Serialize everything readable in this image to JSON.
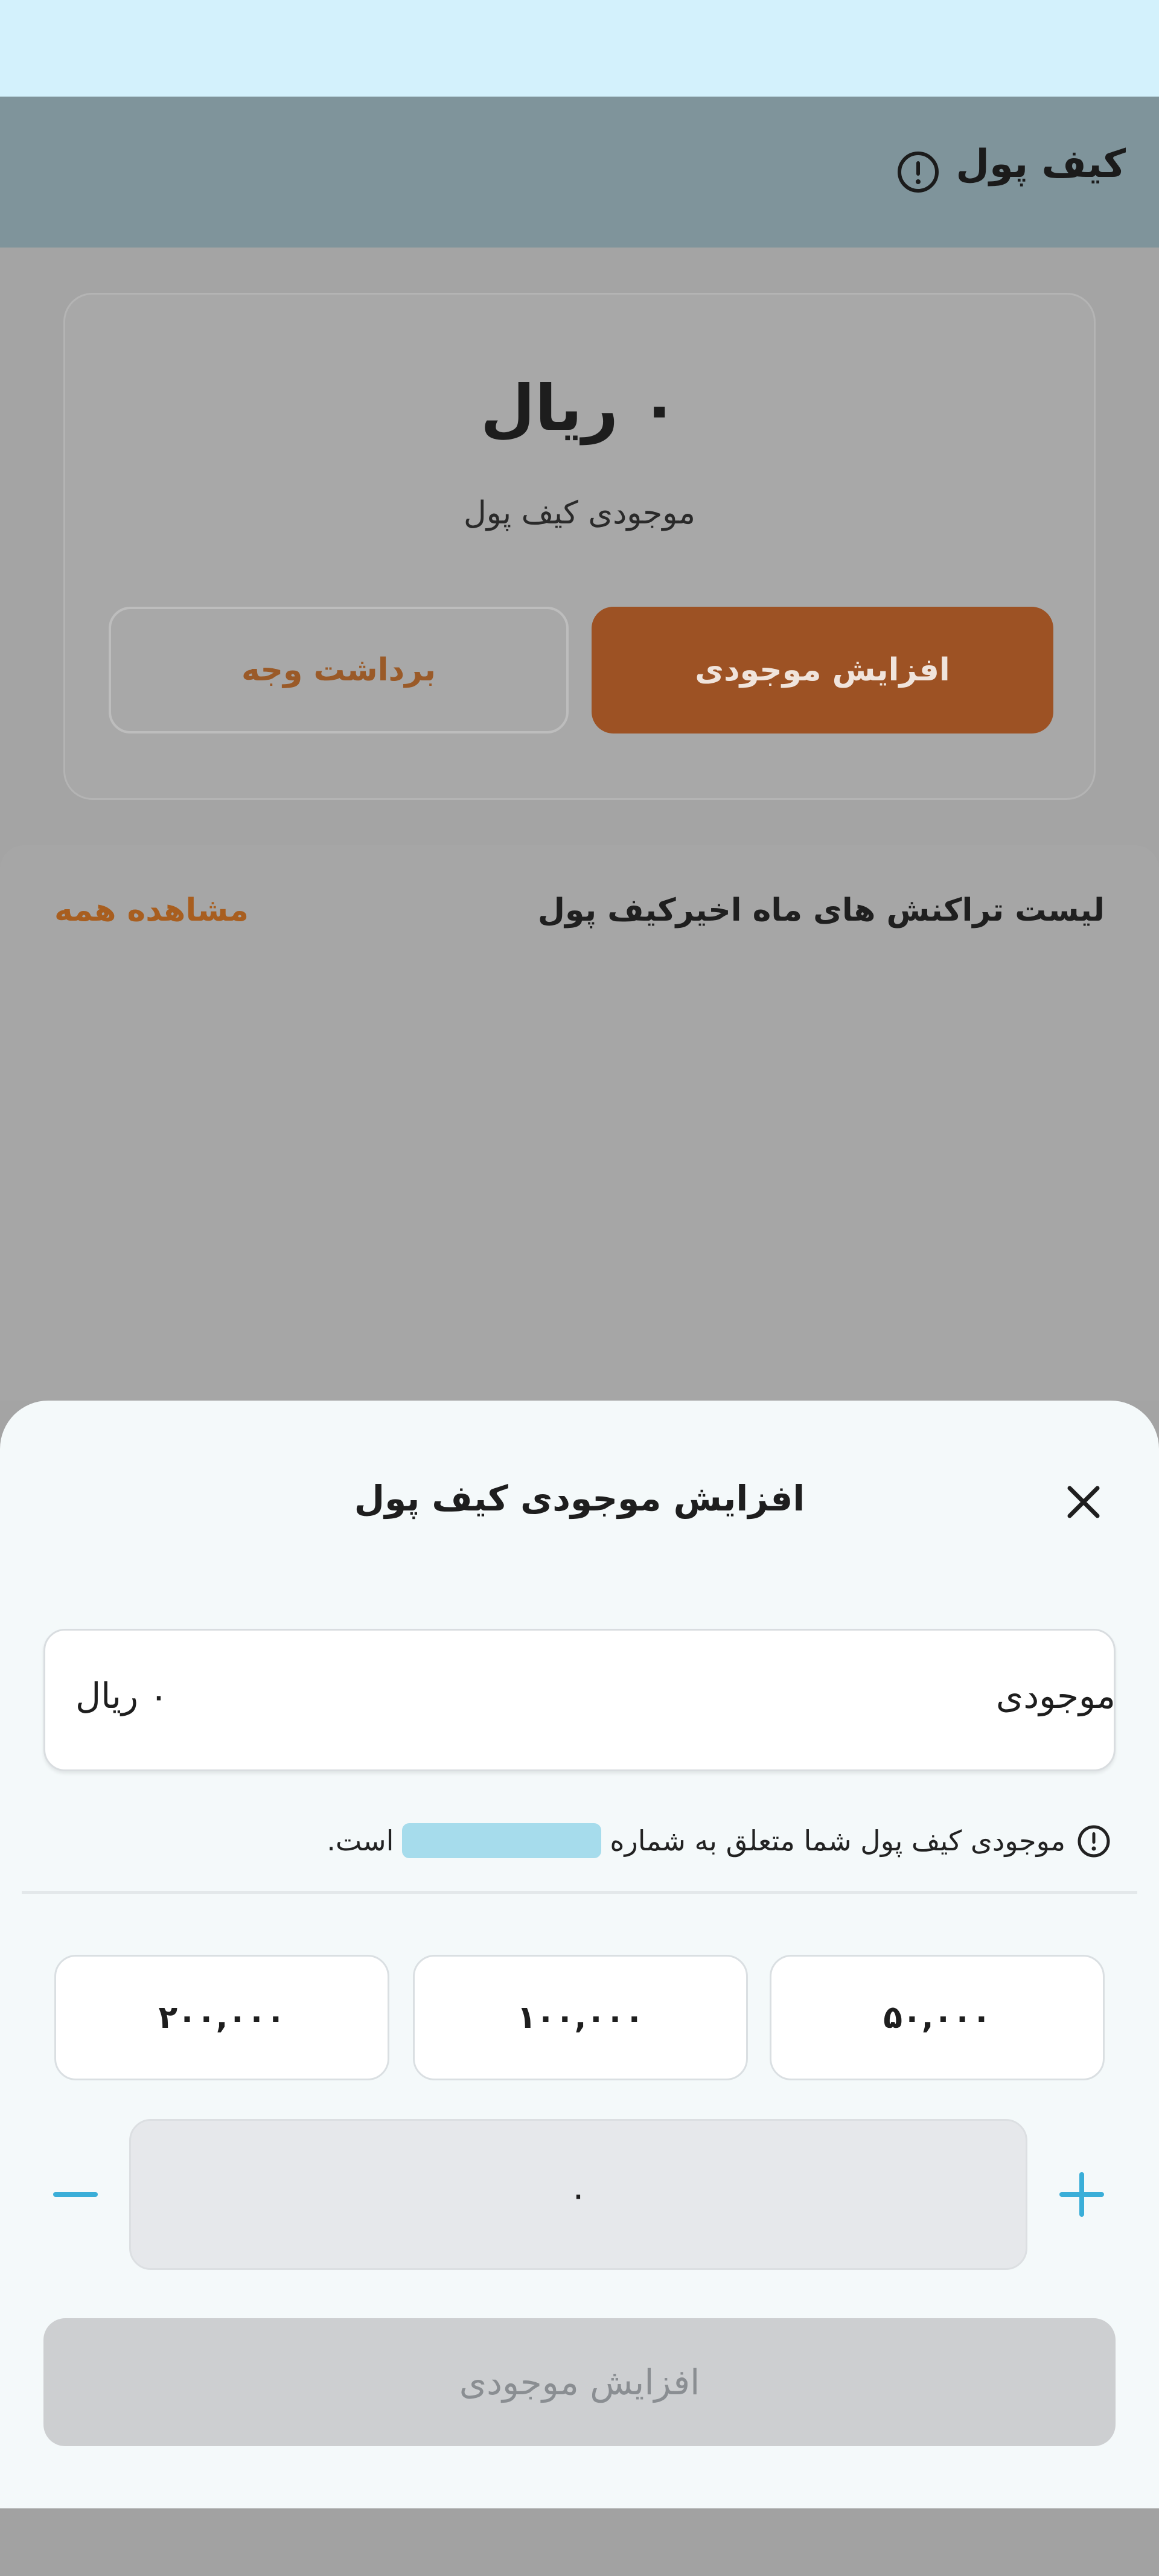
{
  "header": {
    "title": "کیف پول",
    "info_icon": "info-circle-icon"
  },
  "wallet_card": {
    "balance": "۰ ریال",
    "balance_label": "موجودی کیف پول",
    "increase_button": "افزایش موجودی",
    "withdraw_button": "برداشت وجه"
  },
  "transactions": {
    "title": "لیست تراکنش های ماه اخیرکیف پول",
    "view_all": "مشاهده همه"
  },
  "sheet": {
    "title": "افزایش موجودی کیف پول",
    "close_icon": "close-icon",
    "balance_field": {
      "label": "موجودی",
      "value": "۰ ریال"
    },
    "note_before": "موجودی کیف پول شما متعلق به شماره",
    "note_after": "است.",
    "presets": [
      "۵۰,۰۰۰",
      "۱۰۰,۰۰۰",
      "۲۰۰,۰۰۰"
    ],
    "amount": "۰",
    "plus_icon": "plus-icon",
    "minus_icon": "minus-icon",
    "submit_button": "افزایش موجودی"
  },
  "colors": {
    "accent_orange": "#9d5224",
    "link_orange": "#a85e1f",
    "stepper_blue": "#3aaed8",
    "disabled_gray": "#cdcfd1"
  }
}
